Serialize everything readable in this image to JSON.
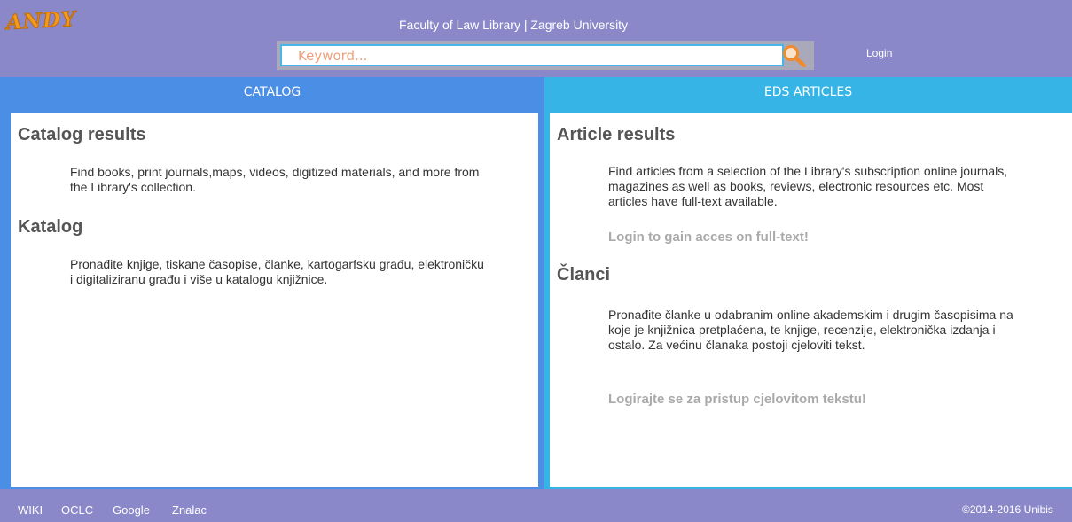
{
  "header": {
    "logo_text": "ANDY",
    "site_title": "Faculty of Law Library | Zagreb University",
    "search_placeholder": "Keyword...",
    "login_label": "Login"
  },
  "tabs": [
    {
      "label": "CATALOG",
      "color": "#4b8ee6"
    },
    {
      "label": "EDS ARTICLES",
      "color": "#37b4e6"
    }
  ],
  "catalog": {
    "heading_en": "Catalog results",
    "desc_en": "Find books, print journals,maps, videos, digitized materials, and more from the Library's collection.",
    "heading_hr": "Katalog",
    "desc_hr": "Pronađite knjige, tiskane časopise, članke, kartogarfsku građu, elektroničku i digitaliziranu građu i više u katalogu knjižnice."
  },
  "articles": {
    "heading_en": "Article results",
    "desc_en": "Find articles from a selection of the Library's subscription online journals, magazines as well as books, reviews, electronic resources etc. Most articles have full-text available.",
    "login_note_en": "Login to gain acces on full-text!",
    "heading_hr": "Članci",
    "desc_hr": "Pronađite članke u odabranim online akademskim i drugim časopisima na koje je knjižnica pretplaćena, te knjige, recenzije, elektronička izdanja i ostalo. Za većinu članaka postoji cjeloviti tekst.",
    "login_note_hr": "Logirajte se za pristup cjelovitom tekstu!"
  },
  "footer": {
    "links": [
      "WIKI",
      "OCLC",
      "Google",
      "Znalac"
    ],
    "copyright": "©2014-2016 Unibis"
  },
  "colors": {
    "header_bg": "#8a88c8",
    "catalog_blue": "#4b8ee6",
    "eds_cyan": "#37b4e6",
    "logo_orange": "#f39a1e"
  },
  "icons": {
    "search": "magnifier-icon"
  }
}
